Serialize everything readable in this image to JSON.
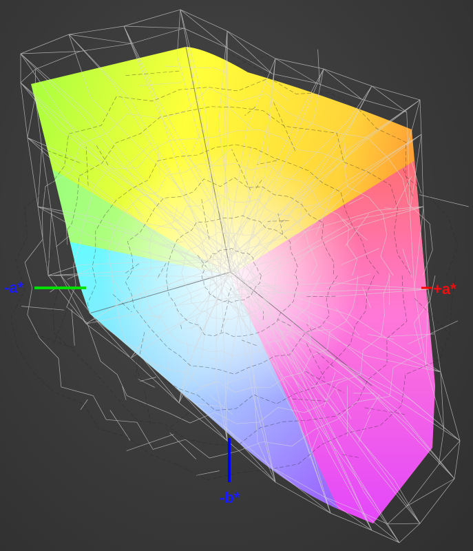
{
  "axes": {
    "neg_a": {
      "label": "-a*",
      "color": "#00e000"
    },
    "pos_a": {
      "label": "+a*",
      "color": "#ff0000"
    },
    "neg_b": {
      "label": "-b*",
      "color": "#0000ff"
    }
  },
  "colors": {
    "background": "#3c3c3c",
    "wireframe": "#d8d8d8",
    "gamut_corners": [
      "#ffff30",
      "#ff7a1a",
      "#ff40ff",
      "#8a40ff",
      "#40ffff",
      "#60ff40"
    ]
  }
}
